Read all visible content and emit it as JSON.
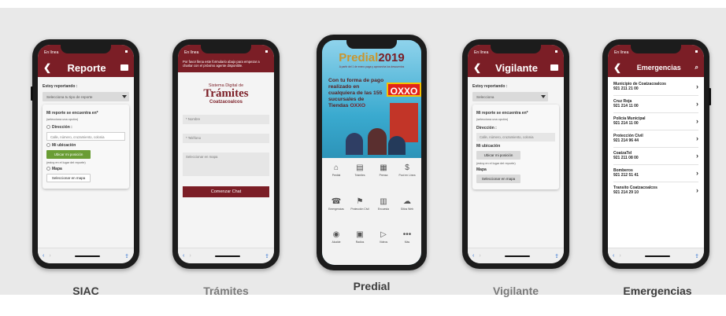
{
  "status_label": "En línea",
  "siac": {
    "caption": "SIAC",
    "title": "Reporte",
    "reporting_label": "Estoy reportando :",
    "type_placeholder": "Selecciona tu tipo de reporte",
    "location_label": "Mi reporte se encuentra en*",
    "location_hint": "(selecciona una opción)",
    "direction_label": "Dirección :",
    "address_placeholder": "Calle, número, cruzamiento, colonia",
    "my_location_label": "Mi ubicación",
    "locate_button": "Ubicar mi posición",
    "locate_hint": "(estoy en el lugar del reporte)",
    "map_label": "Mapa",
    "map_button": "Seleccionar en mapa"
  },
  "tramites": {
    "caption": "Trámites",
    "intro": "Por favor llena este formulario abajo para empezar a charlar con el próximo agente disponible.",
    "logo_line1": "Sistema Digital de",
    "logo_line2": "Trámites",
    "logo_line3": "Coatzacoalcos",
    "name_placeholder": "* Nombre",
    "phone_placeholder": "* Teléfono",
    "map_placeholder": "Seleccionar en mapa",
    "start_button": "Comenzar Chat"
  },
  "predial": {
    "caption": "Predial",
    "brand": "Predial",
    "year": "2019",
    "tagline": "A partir del 1 de enero paga y aprovecha los descuentos",
    "promo_text": "Con tu forma de pago realizado en cualquiera de las 155 sucursales de Tiendas",
    "promo_brand": "OXXO",
    "store_sign": "OXXO",
    "grid": [
      {
        "icon": "house-icon",
        "glyph": "⌂",
        "label": "Predial"
      },
      {
        "icon": "folder-icon",
        "glyph": "▤",
        "label": "Trámites"
      },
      {
        "icon": "newspaper-icon",
        "glyph": "▦",
        "label": "Prensa"
      },
      {
        "icon": "coin-icon",
        "glyph": "$",
        "label": "Pool en Línea"
      },
      {
        "icon": "phone-icon",
        "glyph": "☎",
        "label": "Emergencias"
      },
      {
        "icon": "shield-icon",
        "glyph": "⚑",
        "label": "Protección Civil"
      },
      {
        "icon": "building-icon",
        "glyph": "▥",
        "label": "Encuesta"
      },
      {
        "icon": "cloud-icon",
        "glyph": "☁",
        "label": "Sitios Web"
      },
      {
        "icon": "user-icon",
        "glyph": "◉",
        "label": "Alcalde"
      },
      {
        "icon": "tv-icon",
        "glyph": "▣",
        "label": "Radios"
      },
      {
        "icon": "play-icon",
        "glyph": "▷",
        "label": "Videos"
      },
      {
        "icon": "more-icon",
        "glyph": "•••",
        "label": "Más"
      }
    ]
  },
  "vigilante": {
    "caption": "Vigilante",
    "title": "Vigilante",
    "reporting_label": "Estoy reportando :",
    "type_placeholder": "Selecciona",
    "location_label": "Mi reporte se encuentra en*",
    "location_hint": "(selecciona una opción)",
    "direction_label": "Dirección :",
    "address_placeholder": "Calle, número, cruzamiento, colonia",
    "my_location_label": "Mi ubicación",
    "locate_button": "Ubicar mi posición",
    "locate_hint": "(estoy en el lugar del reporte)",
    "map_label": "Mapa",
    "map_button": "Seleccionar en mapa"
  },
  "emergencias": {
    "caption": "Emergencias",
    "title": "Emergencias",
    "entries": [
      {
        "name": "Municipio de Coatzacoalcos",
        "phone": "921 211 21 00"
      },
      {
        "name": "Cruz Roja",
        "phone": "921 214 11 00"
      },
      {
        "name": "Policía Municipal",
        "phone": "921 214 11 00"
      },
      {
        "name": "Protección Civil",
        "phone": "921 214 96 44"
      },
      {
        "name": "CoatzaTel",
        "phone": "921 211 08 00"
      },
      {
        "name": "Bomberos",
        "phone": "921 212 51 41"
      },
      {
        "name": "Transito Coatzacoalcos",
        "phone": "921 214 29 10"
      }
    ]
  },
  "colors": {
    "brand_maroon": "#7b1e26",
    "accent_green": "#6a9d35",
    "ios_blue": "#2d6fd1",
    "oxxo_red": "#e2231a",
    "predial_gold": "#c9962e"
  }
}
